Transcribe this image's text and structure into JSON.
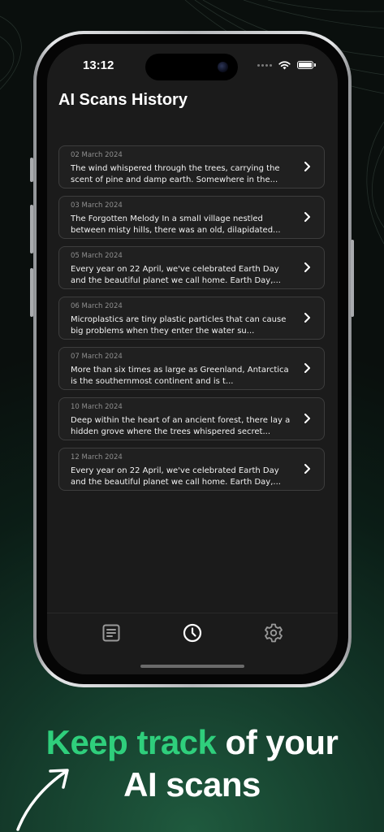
{
  "status_bar": {
    "time": "13:12"
  },
  "page": {
    "title": "AI Scans History"
  },
  "scans": [
    {
      "date": "02 March 2024",
      "preview": "The wind whispered through the trees, carrying the scent of pine and damp earth. Somewhere in the..."
    },
    {
      "date": "03 March 2024",
      "preview": "The Forgotten Melody In a small village nestled between misty hills, there was an old, dilapidated..."
    },
    {
      "date": "05 March 2024",
      "preview": "Every year on 22 April, we've celebrated Earth Day and the beautiful planet we call home. Earth Day,..."
    },
    {
      "date": "06 March 2024",
      "preview": "Microplastics are tiny plastic particles that can cause big problems when they enter the water su..."
    },
    {
      "date": "07 March 2024",
      "preview": "More than six times as large as Greenland, Antarctica is the southernmost continent and is t..."
    },
    {
      "date": "10 March 2024",
      "preview": "Deep within the heart of an ancient forest, there lay a hidden grove where the trees whispered secret..."
    },
    {
      "date": "12 March 2024",
      "preview": "Every year on 22 April, we've celebrated Earth Day and the beautiful planet we call home. Earth Day,..."
    }
  ],
  "tab_bar": {
    "tabs": [
      {
        "icon": "document-icon",
        "active": false
      },
      {
        "icon": "clock-icon",
        "active": true
      },
      {
        "icon": "gear-icon",
        "active": false
      }
    ]
  },
  "promo": {
    "accent_text": "Keep track",
    "text_line1": " of your",
    "text_line2": "AI scans"
  },
  "colors": {
    "accent": "#2fcf7c",
    "screen_bg": "#1b1b1b",
    "card_bg": "#202020"
  }
}
